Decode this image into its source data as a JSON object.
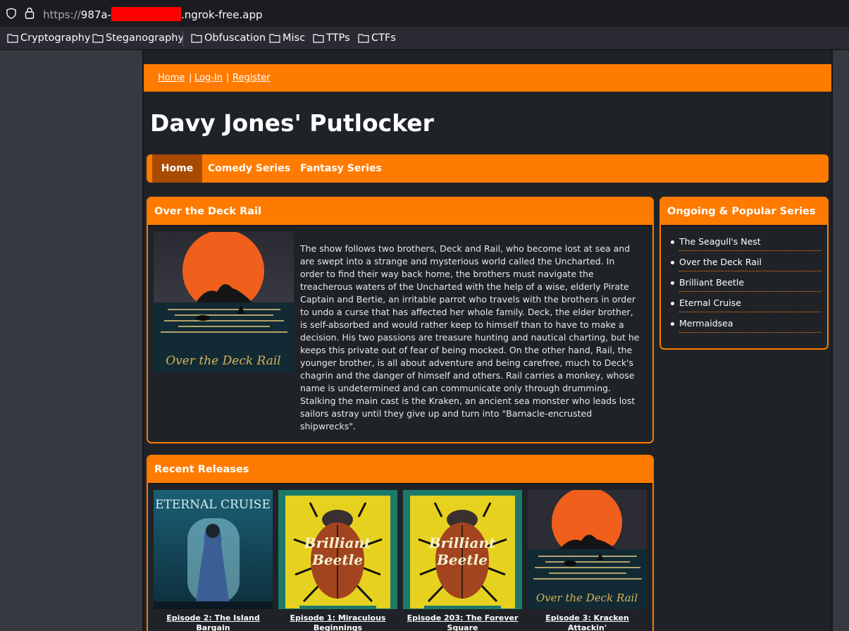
{
  "browser": {
    "url_scheme": "https://",
    "url_prefix": "987a-",
    "url_suffix": ".ngrok-free.app"
  },
  "bookmarks": [
    "Cryptography",
    "Steganography",
    "Obfuscation",
    "Misc",
    "TTPs",
    "CTFs"
  ],
  "topnav": {
    "home": "Home",
    "login": "Log-In",
    "register": "Register",
    "separator": "|"
  },
  "site": {
    "title": "Davy Jones' Putlocker"
  },
  "mainnav": {
    "tabs": [
      "Home",
      "Comedy Series",
      "Fantasy Series"
    ],
    "active": "Home"
  },
  "feature": {
    "title": "Over the Deck Rail",
    "poster_text": "Over the Deck Rail",
    "description": "The show follows two brothers, Deck and Rail, who become lost at sea and are swept into a strange and mysterious world called the Uncharted. In order to find their way back home, the brothers must navigate the treacherous waters of the Uncharted with the help of a wise, elderly Pirate Captain and Bertie, an irritable parrot who travels with the brothers in order to undo a curse that has affected her whole family. Deck, the elder brother, is self-absorbed and would rather keep to himself than to have to make a decision. His two passions are treasure hunting and nautical charting, but he keeps this private out of fear of being mocked. On the other hand, Rail, the younger brother, is all about adventure and being carefree, much to Deck's chagrin and the danger of himself and others. Rail carries a monkey, whose name is undetermined and can communicate only through drumming. Stalking the main cast is the Kraken, an ancient sea monster who leads lost sailors astray until they give up and turn into \"Barnacle-encrusted shipwrecks\"."
  },
  "sidebar": {
    "title": "Ongoing & Popular Series",
    "items": [
      "The Seagull's Nest",
      "Over the Deck Rail",
      "Brilliant Beetle",
      "Eternal Cruise",
      "Mermaidsea"
    ]
  },
  "recent": {
    "title": "Recent Releases",
    "items": [
      {
        "caption": "Episode 2: The Island Bargain",
        "poster_text": "ETERNAL CRUISE"
      },
      {
        "caption": "Episode 1: Miraculous Beginnings",
        "poster_text_1": "Brilliant",
        "poster_text_2": "Beetle"
      },
      {
        "caption": "Episode 203: The Forever Square",
        "poster_text_1": "Brilliant",
        "poster_text_2": "Beetle"
      },
      {
        "caption": "Episode 3: Kracken Attackin'",
        "poster_text": "Over the Deck Rail"
      }
    ]
  },
  "colors": {
    "accent": "#ff7b00",
    "accent_dark": "#a84a00",
    "page_bg": "#1f2328",
    "outer_bg": "#36393f"
  }
}
